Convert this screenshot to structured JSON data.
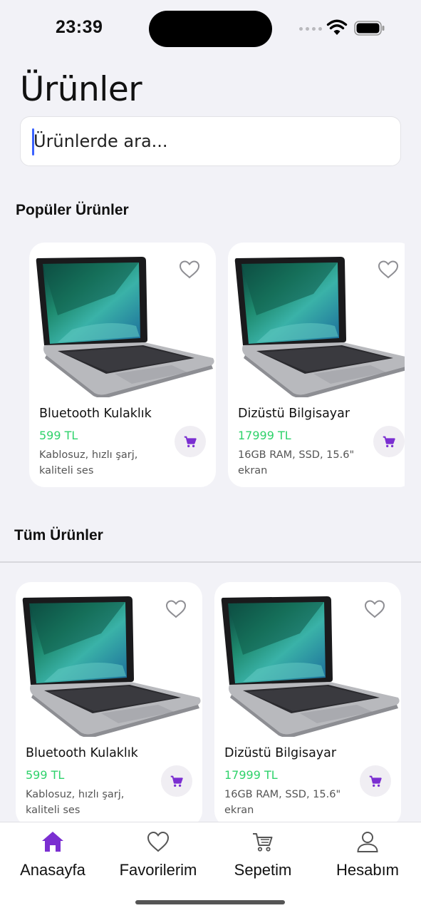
{
  "status_bar": {
    "time": "23:39"
  },
  "page": {
    "title": "Ürünler"
  },
  "search": {
    "placeholder": "Ürünlerde ara..."
  },
  "sections": {
    "popular": "Popüler Ürünler",
    "all": "Tüm Ürünler"
  },
  "popular_products": [
    {
      "name": "Bluetooth Kulaklık",
      "price": "599 TL",
      "description": "Kablosuz, hızlı şarj, kaliteli ses"
    },
    {
      "name": "Dizüstü Bilgisayar",
      "price": "17999 TL",
      "description": "16GB RAM, SSD, 15.6\" ekran"
    }
  ],
  "all_products": [
    {
      "name": "Bluetooth Kulaklık",
      "price": "599 TL",
      "description": "Kablosuz, hızlı şarj, kaliteli ses"
    },
    {
      "name": "Dizüstü Bilgisayar",
      "price": "17999 TL",
      "description": "16GB RAM, SSD, 15.6\" ekran"
    }
  ],
  "tabs": [
    {
      "label": "Anasayfa",
      "icon": "home-icon",
      "active": true
    },
    {
      "label": "Favorilerim",
      "icon": "heart-icon",
      "active": false
    },
    {
      "label": "Sepetim",
      "icon": "cart-icon",
      "active": false
    },
    {
      "label": "Hesabım",
      "icon": "user-icon",
      "active": false
    }
  ],
  "colors": {
    "accent": "#7b2fd1",
    "price": "#2fd26b",
    "background": "#f2f2f7"
  }
}
